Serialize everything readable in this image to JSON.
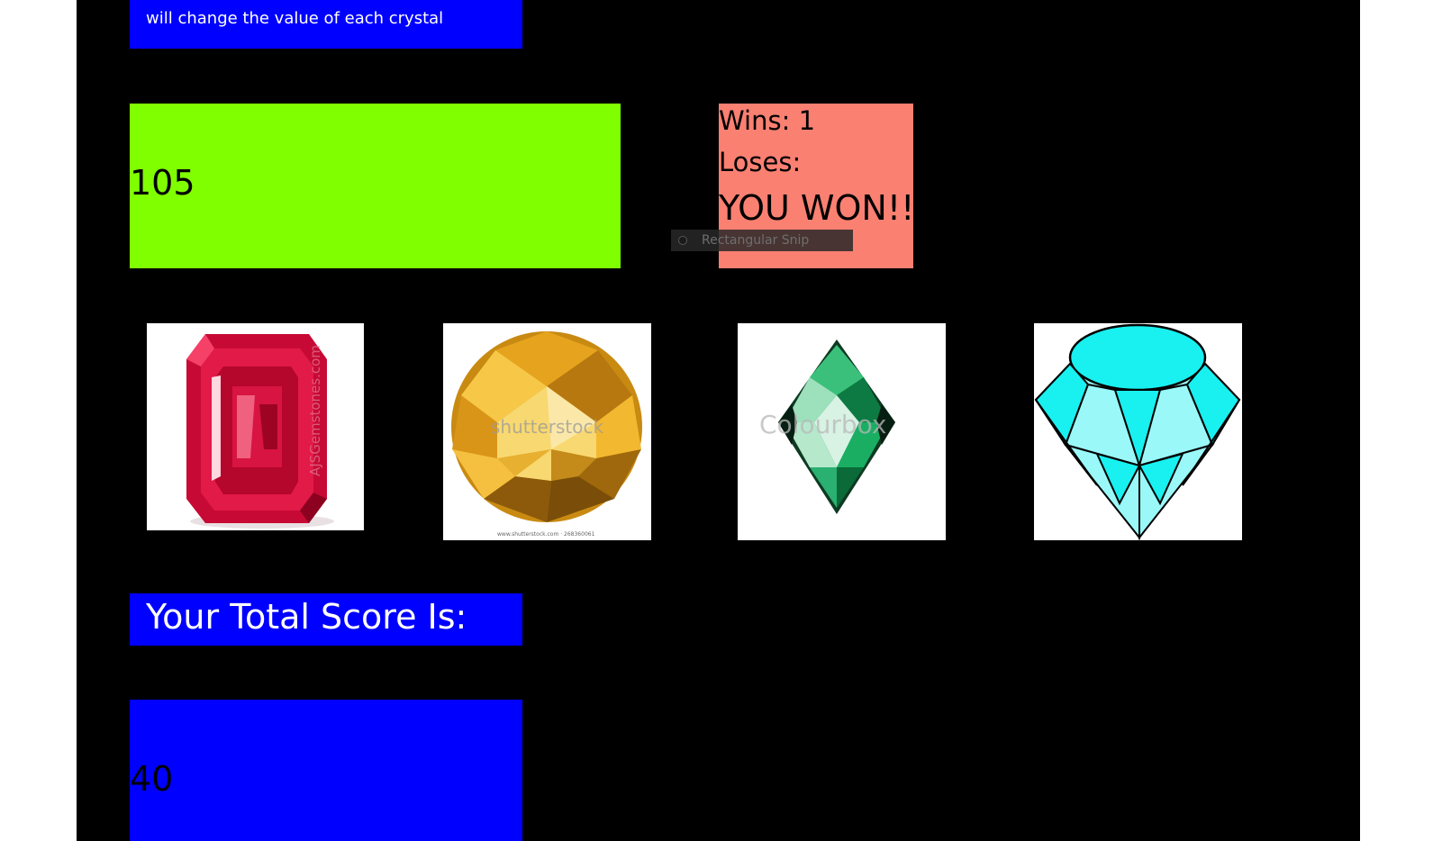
{
  "instructions": {
    "text": "will change the value of each crystal"
  },
  "target": {
    "value": "105"
  },
  "stats": {
    "wins_label": "Wins: 1",
    "loses_label": "Loses:",
    "result": "YOU WON!!"
  },
  "snip_overlay": {
    "label": "Rectangular Snip"
  },
  "crystals": [
    {
      "name": "ruby",
      "watermark": "AJSGemstones.com"
    },
    {
      "name": "topaz",
      "watermark": "shutterstock",
      "caption": "www.shutterstock.com · 268360061"
    },
    {
      "name": "emerald",
      "watermark": "Colourbox"
    },
    {
      "name": "diamond"
    }
  ],
  "score": {
    "label": "Your Total Score Is:",
    "value": "40"
  },
  "colors": {
    "page_bg": "#000000",
    "blue_box": "#0000ff",
    "target_box": "#80ff00",
    "stats_box": "#fa8072",
    "ruby": "#d3123e",
    "topaz": "#e0a41c",
    "emerald": "#1aa860",
    "diamond": "#19f0f0"
  }
}
